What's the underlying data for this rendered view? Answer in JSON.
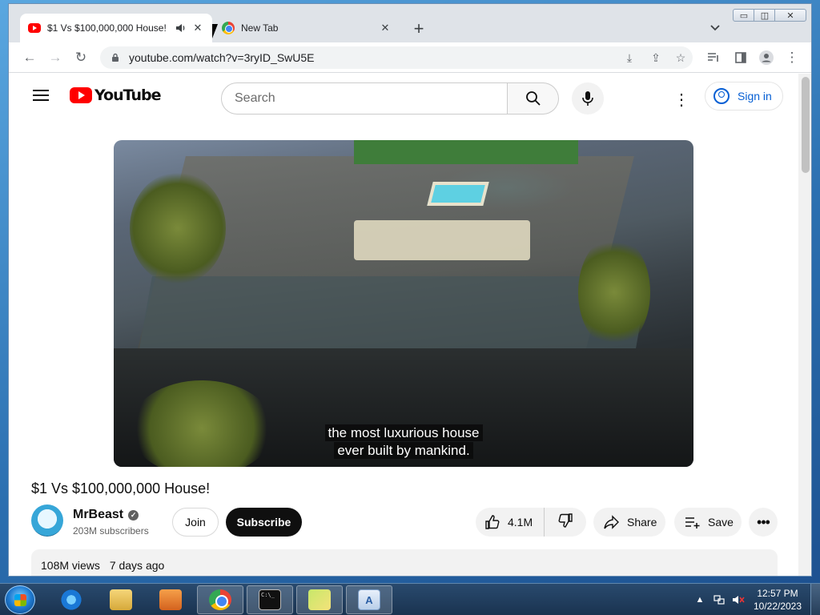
{
  "browser": {
    "tabs": [
      {
        "title": "$1 Vs $100,000,000 House! -",
        "favicon": "youtube-favicon",
        "audio_icon": "speaker-icon",
        "active": true
      },
      {
        "title": "New Tab",
        "favicon": "chrome-favicon",
        "active": false
      }
    ],
    "new_tab_symbol": "+",
    "tab_search_symbol": "⌄",
    "window_controls": {
      "minimize": "▭",
      "maximize": "◫",
      "close": "✕"
    },
    "toolbar": {
      "back": "←",
      "forward": "→",
      "reload": "↻",
      "url": "youtube.com/watch?v=3ryID_SwU5E",
      "lock_icon": "lock-icon",
      "actions": [
        "install-icon",
        "share-icon",
        "star-icon",
        "reading-list-icon",
        "side-panel-icon",
        "profile-icon",
        "menu-icon"
      ]
    }
  },
  "youtube": {
    "logo_text": "YouTube",
    "search_placeholder": "Search",
    "sign_in_label": "Sign in",
    "video": {
      "subtitle_line1": "the most luxurious house",
      "subtitle_line2": "ever built by mankind."
    },
    "title": "$1 Vs $100,000,000 House!",
    "channel": {
      "name": "MrBeast",
      "verified": true,
      "subscribers": "203M subscribers"
    },
    "join_label": "Join",
    "subscribe_label": "Subscribe",
    "likes": "4.1M",
    "share_label": "Share",
    "save_label": "Save",
    "more_symbol": "•••",
    "description": {
      "views": "108M views",
      "age": "7 days ago"
    }
  },
  "taskbar": {
    "apps": [
      "internet-explorer-icon",
      "file-explorer-icon",
      "media-player-icon",
      "chrome-icon",
      "command-prompt-icon",
      "sticky-notes-icon",
      "wordpad-icon"
    ],
    "active_app": "chrome-icon",
    "clock_time": "12:57 PM",
    "clock_date": "10/22/2023"
  },
  "colors": {
    "youtube_red": "#ff0000",
    "link_blue": "#065fd4",
    "subscribe_bg": "#0f0f0f",
    "taskbar_bg": "#1f3d5e"
  }
}
